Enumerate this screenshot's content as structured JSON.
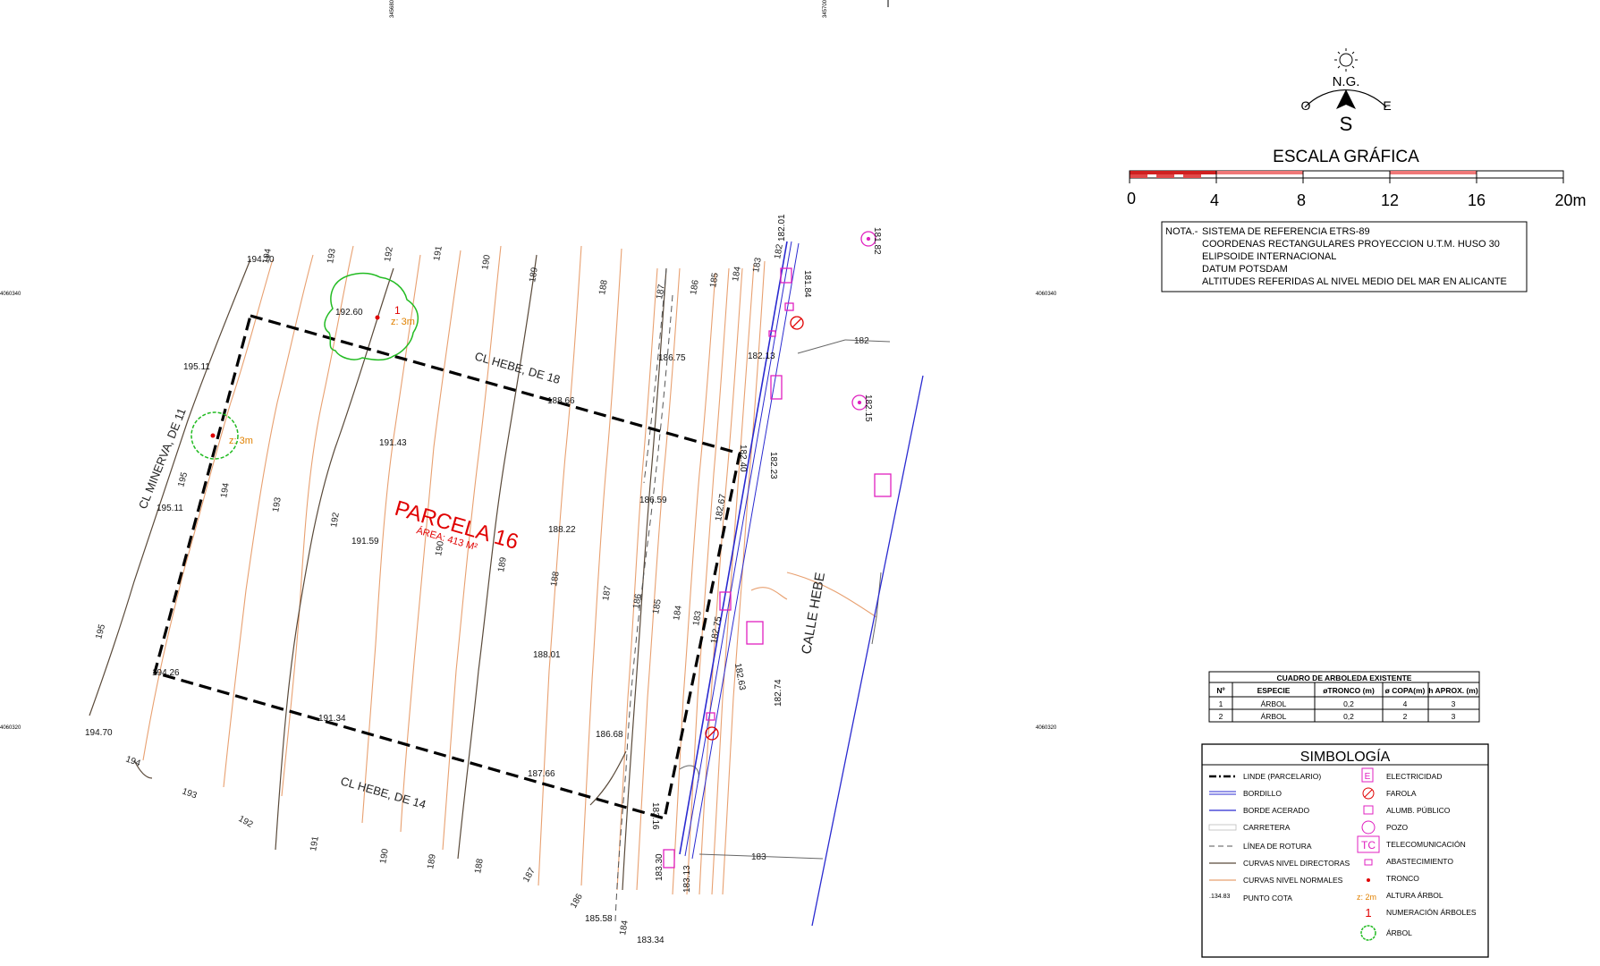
{
  "plot": {
    "title": "PARCELA 16",
    "area": "ÁREA: 413 M²",
    "streets": {
      "hebe_18": "CL HEBE, DE 18",
      "hebe_14": "CL HEBE, DE 14",
      "minerva": "CL MINERVA, DE 11",
      "calle_hebe": "CALLE HEBE"
    }
  },
  "coords": {
    "top_x1": "345680",
    "top_x2": "345700",
    "left_y1": "4060340",
    "left_y2": "4060320",
    "right_y1": "4060340",
    "right_y2": "4060320"
  },
  "contour_labels": {
    "c195_top": "195",
    "c194_top": "194",
    "c193_top": "193",
    "c192_top": "192",
    "c191_top": "191",
    "c190_top": "190",
    "c189_top": "189",
    "c188_top": "188",
    "c187_top": "187",
    "c186_top": "186",
    "c185_top": "185",
    "c184_top": "184",
    "c183_top": "183",
    "c182_top": "182",
    "c194_mid": "194",
    "c193_mid": "193",
    "c192_mid": "192",
    "c190_mid": "190",
    "c189_mid": "189",
    "c188_mid": "188",
    "c187_mid": "187",
    "c186_mid": "186",
    "c185_mid": "185",
    "c184_mid": "184",
    "c183_mid": "183",
    "c195_left": "195",
    "c195_low": "195",
    "c194_bot": "194",
    "c193_bot": "193",
    "c192_bot": "192",
    "c191_bot": "191",
    "c190_bot": "190",
    "c189_bot": "189",
    "c188_bot": "188",
    "c187_bot": "187",
    "c186_bot": "186",
    "c184_bot": "184",
    "c183_r": "183",
    "c182_r": "182"
  },
  "spot_heights": {
    "h194_70a": "194.70",
    "h192_60": "192.60",
    "h195_11a": "195.11",
    "h195_11b": "195.11",
    "h191_43": "191.43",
    "h191_59": "191.59",
    "h188_66": "188.66",
    "h188_22": "188.22",
    "h186_75": "186.75",
    "h186_59": "186.59",
    "h182_13": "182.13",
    "h182_40": "182.40",
    "h182_23": "182.23",
    "h182_01": "182.01",
    "h181_84": "181.84",
    "h181_82": "181.82",
    "h182_15": "182.15",
    "h182_67": "182.67",
    "h182_75": "182.75",
    "h182_63": "182.63",
    "h182_74": "182.74",
    "h194_26": "194.26",
    "h194_70b": "194.70",
    "h191_34": "191.34",
    "h188_01": "188.01",
    "h186_68": "186.68",
    "h187_66": "187.66",
    "h183_16": "183.16",
    "h183_30": "183.30",
    "h183_13": "183.13",
    "h185_58": "185.58",
    "h183_34": "183.34"
  },
  "trees": {
    "t1_num": "1",
    "t1_height": "z: 3m",
    "t2_height": "z: 3m"
  },
  "compass": {
    "north": "N.G.",
    "west": "O",
    "east": "E",
    "south": "S"
  },
  "scale": {
    "title": "ESCALA GRÁFICA",
    "ticks": [
      "0",
      "4",
      "8",
      "12",
      "16",
      "20m"
    ]
  },
  "note": {
    "prefix": "NOTA.-",
    "lines": [
      "SISTEMA DE REFERENCIA ETRS-89",
      "COORDENAS RECTANGULARES PROYECCION U.T.M. HUSO 30",
      "ELIPSOIDE  INTERNACIONAL",
      "DATUM POTSDAM",
      "ALTITUDES REFERIDAS AL NIVEL MEDIO DEL MAR EN ALICANTE"
    ]
  },
  "tree_table": {
    "title": "CUADRO DE ARBOLEDA EXISTENTE",
    "headers": [
      "Nº",
      "ESPECIE",
      "øTRONCO (m)",
      "ø COPA(m)",
      "h APROX. (m)"
    ],
    "rows": [
      [
        "1",
        "ÁRBOL",
        "0,2",
        "4",
        "3"
      ],
      [
        "2",
        "ÁRBOL",
        "0,2",
        "2",
        "3"
      ]
    ]
  },
  "legend": {
    "title": "SIMBOLOGÍA",
    "left": [
      "LINDE (PARCELARIO)",
      "BORDILLO",
      "BORDE ACERADO",
      "CARRETERA",
      "LÍNEA DE ROTURA",
      "CURVAS NIVEL DIRECTORAS",
      "CURVAS NIVEL NORMALES",
      "PUNTO COTA"
    ],
    "point_sample": ".134.83",
    "right": [
      "ELECTRICIDAD",
      "FAROLA",
      "ALUMB. PÚBLICO",
      "POZO",
      "TELECOMUNICACIÓN",
      "ABASTECIMIENTO",
      "TRONCO",
      "ALTURA ÁRBOL",
      "NUMERACIÓN ÁRBOLES",
      "ÁRBOL"
    ],
    "sym_e": "E",
    "sym_tc": "TC",
    "sym_z": "z: 2m",
    "sym_num": "1"
  },
  "colors": {
    "contour_master": "#5a4a3a",
    "contour_normal": "#e8a070",
    "boundary": "#000000",
    "kerb": "#2a2ad0",
    "magenta": "#e020c0",
    "red": "#e00000",
    "tree": "#22bb22",
    "road": "#666666"
  }
}
